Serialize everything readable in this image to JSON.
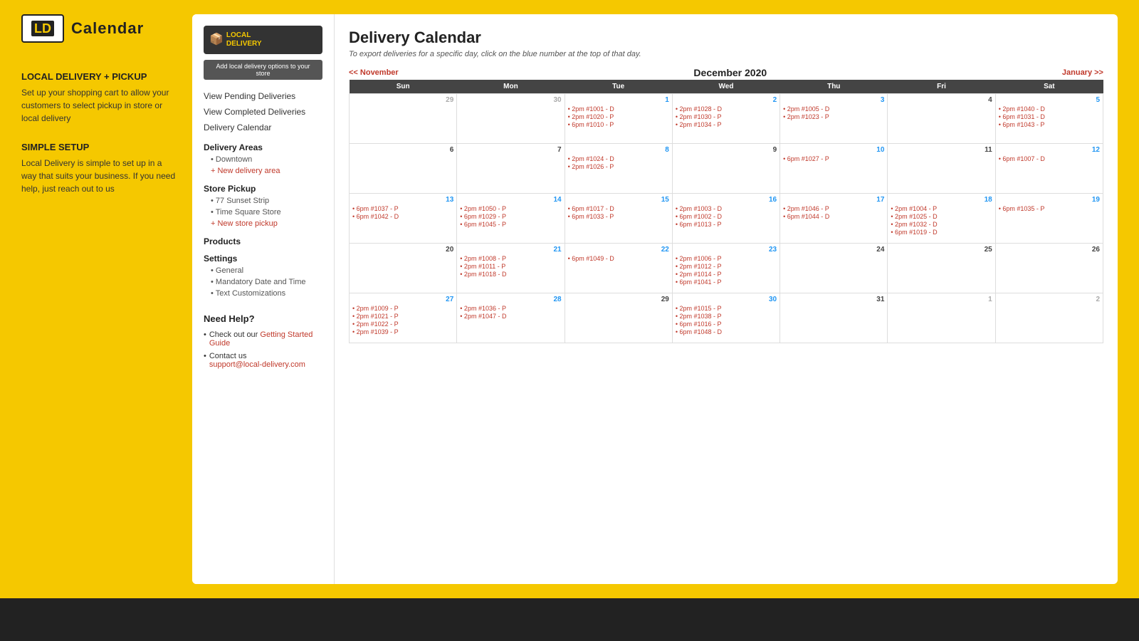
{
  "leftPanel": {
    "logoText": "Calendar",
    "sections": [
      {
        "heading": "LOCAL DELIVERY + PICKUP",
        "text": "Set up your shopping cart to allow your customers to select pickup in store or local delivery"
      },
      {
        "heading": "SIMPLE SETUP",
        "text": "Local Delivery is simple to set up in a way that suits your business. If you need help, just reach out to us"
      }
    ]
  },
  "cardSidebar": {
    "logoLine1": "LOCAL",
    "logoLine2": "DELIVERY",
    "addBtnLabel": "Add local delivery options to your store",
    "navLinks": [
      "View Pending Deliveries",
      "View Completed Deliveries",
      "Delivery Calendar"
    ],
    "deliveryAreas": {
      "title": "Delivery Areas",
      "items": [
        "Downtown"
      ],
      "addLink": "+ New delivery area"
    },
    "storePickup": {
      "title": "Store Pickup",
      "items": [
        "77 Sunset Strip",
        "Time Square Store"
      ],
      "addLink": "+ New store pickup"
    },
    "products": {
      "title": "Products"
    },
    "settings": {
      "title": "Settings",
      "items": [
        "General",
        "Mandatory Date and Time",
        "Text Customizations"
      ]
    },
    "needHelp": {
      "title": "Need Help?",
      "gettingStarted": "Getting Started Guide",
      "contactLabel": "Contact us",
      "email": "support@local-delivery.com"
    }
  },
  "calendar": {
    "title": "Delivery Calendar",
    "subtitle": "To export deliveries for a specific day, click on the blue number at the top of that day.",
    "prevLabel": "<< November",
    "nextLabel": "January >>",
    "monthTitle": "December 2020",
    "headers": [
      "Sun",
      "Mon",
      "Tue",
      "Wed",
      "Thu",
      "Fri",
      "Sat"
    ],
    "weeks": [
      [
        {
          "day": "29",
          "otherMonth": true,
          "events": []
        },
        {
          "day": "30",
          "otherMonth": true,
          "events": []
        },
        {
          "day": "1",
          "blue": true,
          "events": [
            {
              "time": "2pm",
              "num": "#1001",
              "type": "D"
            },
            {
              "time": "2pm",
              "num": "#1020",
              "type": "P"
            },
            {
              "time": "6pm",
              "num": "#1010",
              "type": "P"
            }
          ]
        },
        {
          "day": "2",
          "blue": true,
          "events": [
            {
              "time": "2pm",
              "num": "#1028",
              "type": "D"
            },
            {
              "time": "2pm",
              "num": "#1030",
              "type": "P"
            },
            {
              "time": "2pm",
              "num": "#1034",
              "type": "P"
            }
          ]
        },
        {
          "day": "3",
          "blue": true,
          "events": [
            {
              "time": "2pm",
              "num": "#1005",
              "type": "D"
            },
            {
              "time": "2pm",
              "num": "#1023",
              "type": "P"
            }
          ]
        },
        {
          "day": "4",
          "events": []
        },
        {
          "day": "5",
          "blue": true,
          "events": [
            {
              "time": "2pm",
              "num": "#1040",
              "type": "D"
            },
            {
              "time": "6pm",
              "num": "#1031",
              "type": "D"
            },
            {
              "time": "6pm",
              "num": "#1043",
              "type": "P"
            }
          ]
        }
      ],
      [
        {
          "day": "6",
          "events": []
        },
        {
          "day": "7",
          "events": []
        },
        {
          "day": "8",
          "blue": true,
          "events": [
            {
              "time": "2pm",
              "num": "#1024",
              "type": "D"
            },
            {
              "time": "2pm",
              "num": "#1026",
              "type": "P"
            }
          ]
        },
        {
          "day": "9",
          "events": []
        },
        {
          "day": "10",
          "blue": true,
          "events": [
            {
              "time": "6pm",
              "num": "#1027",
              "type": "P"
            }
          ]
        },
        {
          "day": "11",
          "events": []
        },
        {
          "day": "12",
          "blue": true,
          "events": [
            {
              "time": "6pm",
              "num": "#1007",
              "type": "D"
            }
          ]
        }
      ],
      [
        {
          "day": "13",
          "blue": true,
          "events": [
            {
              "time": "6pm",
              "num": "#1037",
              "type": "P"
            },
            {
              "time": "6pm",
              "num": "#1042",
              "type": "D"
            }
          ]
        },
        {
          "day": "14",
          "blue": true,
          "events": [
            {
              "time": "2pm",
              "num": "#1050",
              "type": "P"
            },
            {
              "time": "6pm",
              "num": "#1029",
              "type": "P"
            },
            {
              "time": "6pm",
              "num": "#1045",
              "type": "P"
            }
          ]
        },
        {
          "day": "15",
          "blue": true,
          "events": [
            {
              "time": "6pm",
              "num": "#1017",
              "type": "D"
            },
            {
              "time": "6pm",
              "num": "#1033",
              "type": "P"
            }
          ]
        },
        {
          "day": "16",
          "blue": true,
          "events": [
            {
              "time": "2pm",
              "num": "#1003",
              "type": "D"
            },
            {
              "time": "6pm",
              "num": "#1002",
              "type": "D"
            },
            {
              "time": "6pm",
              "num": "#1013",
              "type": "P"
            }
          ]
        },
        {
          "day": "17",
          "blue": true,
          "events": [
            {
              "time": "2pm",
              "num": "#1046",
              "type": "P"
            },
            {
              "time": "6pm",
              "num": "#1044",
              "type": "D"
            }
          ]
        },
        {
          "day": "18",
          "blue": true,
          "events": [
            {
              "time": "2pm",
              "num": "#1004",
              "type": "P"
            },
            {
              "time": "2pm",
              "num": "#1025",
              "type": "D"
            },
            {
              "time": "2pm",
              "num": "#1032",
              "type": "D"
            },
            {
              "time": "6pm",
              "num": "#1019",
              "type": "D"
            }
          ]
        },
        {
          "day": "19",
          "blue": true,
          "events": [
            {
              "time": "6pm",
              "num": "#1035",
              "type": "P"
            }
          ]
        }
      ],
      [
        {
          "day": "20",
          "events": []
        },
        {
          "day": "21",
          "blue": true,
          "events": [
            {
              "time": "2pm",
              "num": "#1008",
              "type": "P"
            },
            {
              "time": "2pm",
              "num": "#1011",
              "type": "P"
            },
            {
              "time": "2pm",
              "num": "#1018",
              "type": "D"
            }
          ]
        },
        {
          "day": "22",
          "blue": true,
          "events": [
            {
              "time": "6pm",
              "num": "#1049",
              "type": "D"
            }
          ]
        },
        {
          "day": "23",
          "blue": true,
          "events": [
            {
              "time": "2pm",
              "num": "#1006",
              "type": "P"
            },
            {
              "time": "2pm",
              "num": "#1012",
              "type": "P"
            },
            {
              "time": "2pm",
              "num": "#1014",
              "type": "P"
            },
            {
              "time": "6pm",
              "num": "#1041",
              "type": "P"
            }
          ]
        },
        {
          "day": "24",
          "events": []
        },
        {
          "day": "25",
          "events": []
        },
        {
          "day": "26",
          "events": []
        }
      ],
      [
        {
          "day": "27",
          "blue": true,
          "events": [
            {
              "time": "2pm",
              "num": "#1009",
              "type": "P"
            },
            {
              "time": "2pm",
              "num": "#1021",
              "type": "P"
            },
            {
              "time": "2pm",
              "num": "#1022",
              "type": "P"
            },
            {
              "time": "2pm",
              "num": "#1039",
              "type": "P"
            }
          ]
        },
        {
          "day": "28",
          "blue": true,
          "events": [
            {
              "time": "2pm",
              "num": "#1036",
              "type": "P"
            },
            {
              "time": "2pm",
              "num": "#1047",
              "type": "D"
            }
          ]
        },
        {
          "day": "29",
          "events": []
        },
        {
          "day": "30",
          "blue": true,
          "events": [
            {
              "time": "2pm",
              "num": "#1015",
              "type": "P"
            },
            {
              "time": "2pm",
              "num": "#1038",
              "type": "P"
            },
            {
              "time": "6pm",
              "num": "#1016",
              "type": "P"
            },
            {
              "time": "6pm",
              "num": "#1048",
              "type": "D"
            }
          ]
        },
        {
          "day": "31",
          "events": []
        },
        {
          "day": "1",
          "otherMonth": true,
          "events": []
        },
        {
          "day": "2",
          "otherMonth": true,
          "events": []
        }
      ]
    ]
  }
}
